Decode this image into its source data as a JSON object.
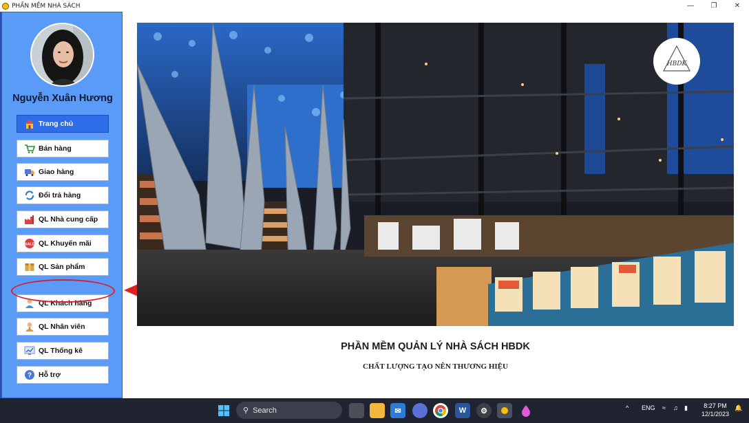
{
  "window": {
    "title": "PHẦN MỀM NHÀ SÁCH",
    "controls": [
      "minimize-icon",
      "restore-icon",
      "close-icon"
    ]
  },
  "sidebar": {
    "user_name": "Nguyễn Xuân Hương",
    "items": [
      {
        "label": "Trang chủ",
        "icon": "home-icon",
        "active": true
      },
      {
        "label": "Bán hàng",
        "icon": "cart-icon",
        "active": false
      },
      {
        "label": "Giao hàng",
        "icon": "truck-icon",
        "active": false
      },
      {
        "label": "Đổi trả hàng",
        "icon": "refresh-icon",
        "active": false
      },
      {
        "label": "QL Nhà cung cấp",
        "icon": "factory-icon",
        "active": false
      },
      {
        "label": "QL Khuyến mãi",
        "icon": "sale-icon",
        "active": false
      },
      {
        "label": "QL Sản phẩm",
        "icon": "box-icon",
        "active": false
      },
      {
        "label": "QL Khách hàng",
        "icon": "customer-icon",
        "active": false,
        "highlighted": true
      },
      {
        "label": "QL Nhân viên",
        "icon": "employee-icon",
        "active": false
      },
      {
        "label": "QL Thống kê",
        "icon": "chart-icon",
        "active": false
      },
      {
        "label": "Hỗ trợ",
        "icon": "help-icon",
        "active": false
      }
    ]
  },
  "main": {
    "title": "PHẦN MỀM QUẢN LÝ NHÀ SÁCH HBDK",
    "subtitle": "CHẤT LƯỢNG TẠO NÊN THƯƠNG HIỆU",
    "logo_text": "HBDK"
  },
  "taskbar": {
    "search_label": "Search",
    "language": "ENG",
    "time": "8:27 PM",
    "date": "12/1/2023"
  },
  "colors": {
    "sidebar": "#5b9bf8",
    "active_button": "#2e6de8",
    "highlight": "#d81e2a",
    "taskbar": "#1f2430"
  }
}
